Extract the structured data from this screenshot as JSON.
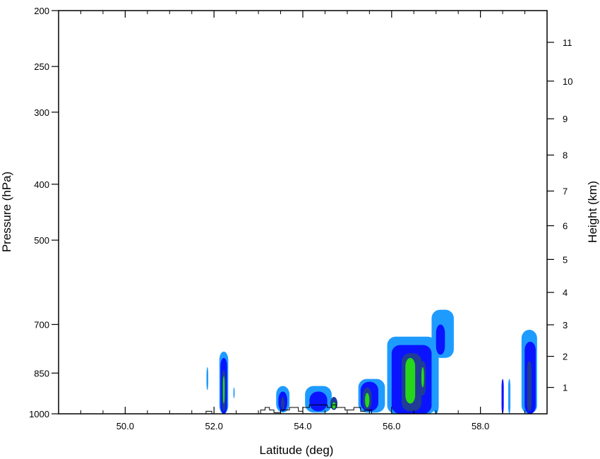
{
  "chart_data": {
    "type": "heatmap",
    "title": "",
    "xlabel": "Latitude (deg)",
    "ylabel_left": "Pressure (hPa)",
    "ylabel_right": "Height (km)",
    "xlim": [
      48.5,
      59.5
    ],
    "ylim_pressure": [
      1000,
      200
    ],
    "y_scale": "log-pressure",
    "x_ticks": [
      {
        "value": 50,
        "label": "50.0"
      },
      {
        "value": 52,
        "label": "52.0"
      },
      {
        "value": 54,
        "label": "54.0"
      },
      {
        "value": 56,
        "label": "56.0"
      },
      {
        "value": 58,
        "label": "58.0"
      }
    ],
    "y_ticks_pressure": [
      {
        "value": 200,
        "label": "200"
      },
      {
        "value": 250,
        "label": "250"
      },
      {
        "value": 300,
        "label": "300"
      },
      {
        "value": 400,
        "label": "400"
      },
      {
        "value": 500,
        "label": "500"
      },
      {
        "value": 700,
        "label": "700"
      },
      {
        "value": 850,
        "label": "850"
      },
      {
        "value": 1000,
        "label": "1000"
      }
    ],
    "y_ticks_height": [
      {
        "value": 1,
        "label": "1",
        "p": 900
      },
      {
        "value": 2,
        "label": "2",
        "p": 795
      },
      {
        "value": 3,
        "label": "3",
        "p": 701
      },
      {
        "value": 4,
        "label": "4",
        "p": 616
      },
      {
        "value": 5,
        "label": "5",
        "p": 540
      },
      {
        "value": 6,
        "label": "6",
        "p": 472
      },
      {
        "value": 7,
        "label": "7",
        "p": 411
      },
      {
        "value": 8,
        "label": "8",
        "p": 356
      },
      {
        "value": 9,
        "label": "9",
        "p": 308
      },
      {
        "value": 10,
        "label": "10",
        "p": 265
      },
      {
        "value": 11,
        "label": "11",
        "p": 227
      }
    ],
    "fill_levels": [
      {
        "level": 1,
        "color": "#1e9bff"
      },
      {
        "level": 2,
        "color": "#0a14ff"
      },
      {
        "level": 3,
        "color": "#1f3c96"
      },
      {
        "level": 4,
        "color": "#27d81a"
      }
    ],
    "cells": [
      {
        "lat": 51.85,
        "w": 0.04,
        "p_bot": 910,
        "p_top": 830,
        "level": 1
      },
      {
        "lat": 52.22,
        "w": 0.2,
        "p_bot": 1000,
        "p_top": 780,
        "level": 1
      },
      {
        "lat": 52.22,
        "w": 0.15,
        "p_bot": 1000,
        "p_top": 800,
        "level": 2
      },
      {
        "lat": 52.22,
        "w": 0.08,
        "p_bot": 990,
        "p_top": 840,
        "level": 3
      },
      {
        "lat": 52.22,
        "w": 0.04,
        "p_bot": 960,
        "p_top": 860,
        "level": 4
      },
      {
        "lat": 52.45,
        "w": 0.03,
        "p_bot": 940,
        "p_top": 900,
        "level": 1
      },
      {
        "lat": 53.55,
        "w": 0.3,
        "p_bot": 995,
        "p_top": 895,
        "level": 1
      },
      {
        "lat": 53.55,
        "w": 0.2,
        "p_bot": 990,
        "p_top": 915,
        "level": 2
      },
      {
        "lat": 53.55,
        "w": 0.08,
        "p_bot": 985,
        "p_top": 935,
        "level": 3
      },
      {
        "lat": 54.35,
        "w": 0.6,
        "p_bot": 995,
        "p_top": 895,
        "level": 1
      },
      {
        "lat": 54.35,
        "w": 0.4,
        "p_bot": 990,
        "p_top": 915,
        "level": 2
      },
      {
        "lat": 54.7,
        "w": 0.16,
        "p_bot": 985,
        "p_top": 935,
        "level": 3
      },
      {
        "lat": 54.7,
        "w": 0.08,
        "p_bot": 980,
        "p_top": 955,
        "level": 4
      },
      {
        "lat": 55.55,
        "w": 0.6,
        "p_bot": 995,
        "p_top": 870,
        "level": 1
      },
      {
        "lat": 55.5,
        "w": 0.4,
        "p_bot": 990,
        "p_top": 880,
        "level": 2
      },
      {
        "lat": 55.45,
        "w": 0.2,
        "p_bot": 985,
        "p_top": 900,
        "level": 3
      },
      {
        "lat": 55.45,
        "w": 0.1,
        "p_bot": 975,
        "p_top": 920,
        "level": 4
      },
      {
        "lat": 56.45,
        "w": 1.1,
        "p_bot": 1000,
        "p_top": 735,
        "level": 1
      },
      {
        "lat": 56.45,
        "w": 0.9,
        "p_bot": 1000,
        "p_top": 760,
        "level": 2
      },
      {
        "lat": 56.45,
        "w": 0.45,
        "p_bot": 990,
        "p_top": 785,
        "level": 3
      },
      {
        "lat": 56.42,
        "w": 0.22,
        "p_bot": 960,
        "p_top": 800,
        "level": 4
      },
      {
        "lat": 56.7,
        "w": 0.14,
        "p_bot": 930,
        "p_top": 810,
        "level": 3
      },
      {
        "lat": 56.7,
        "w": 0.06,
        "p_bot": 900,
        "p_top": 830,
        "level": 4
      },
      {
        "lat": 57.15,
        "w": 0.5,
        "p_bot": 800,
        "p_top": 660,
        "level": 1
      },
      {
        "lat": 57.1,
        "w": 0.2,
        "p_bot": 790,
        "p_top": 700,
        "level": 2
      },
      {
        "lat": 57.0,
        "w": 0.12,
        "p_bot": 1000,
        "p_top": 770,
        "level": 1
      },
      {
        "lat": 58.5,
        "w": 0.05,
        "p_bot": 1000,
        "p_top": 870,
        "level": 2
      },
      {
        "lat": 58.65,
        "w": 0.05,
        "p_bot": 1000,
        "p_top": 870,
        "level": 1
      },
      {
        "lat": 59.1,
        "w": 0.35,
        "p_bot": 1000,
        "p_top": 715,
        "level": 1
      },
      {
        "lat": 59.12,
        "w": 0.25,
        "p_bot": 1000,
        "p_top": 750,
        "level": 2
      },
      {
        "lat": 59.1,
        "w": 0.1,
        "p_bot": 990,
        "p_top": 810,
        "level": 3
      }
    ],
    "terrain_outline": [
      [
        51.82,
        1000
      ],
      [
        51.82,
        990
      ],
      [
        51.95,
        990
      ],
      [
        51.95,
        1000
      ],
      [
        53.05,
        1000
      ],
      [
        53.05,
        985
      ],
      [
        53.15,
        985
      ],
      [
        53.15,
        975
      ],
      [
        53.25,
        975
      ],
      [
        53.25,
        985
      ],
      [
        53.35,
        985
      ],
      [
        53.35,
        995
      ],
      [
        53.5,
        995
      ],
      [
        53.5,
        985
      ],
      [
        53.7,
        985
      ],
      [
        53.7,
        975
      ],
      [
        53.9,
        975
      ],
      [
        53.9,
        990
      ],
      [
        54.0,
        990
      ],
      [
        54.0,
        975
      ],
      [
        54.15,
        975
      ],
      [
        54.15,
        965
      ],
      [
        54.55,
        965
      ],
      [
        54.55,
        975
      ],
      [
        54.65,
        975
      ],
      [
        54.65,
        965
      ],
      [
        54.75,
        965
      ],
      [
        54.75,
        975
      ],
      [
        54.95,
        975
      ],
      [
        54.95,
        985
      ],
      [
        55.15,
        985
      ],
      [
        55.15,
        975
      ],
      [
        55.3,
        975
      ],
      [
        55.3,
        990
      ],
      [
        55.4,
        990
      ],
      [
        55.4,
        985
      ],
      [
        55.55,
        985
      ],
      [
        55.55,
        1000
      ]
    ]
  }
}
